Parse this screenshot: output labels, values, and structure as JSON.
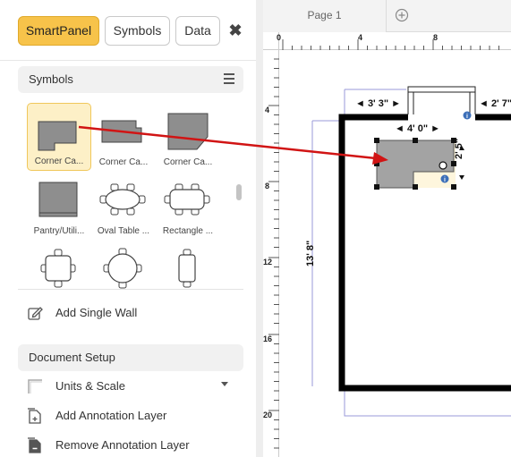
{
  "panel": {
    "tabs": [
      {
        "label": "SmartPanel",
        "active": true
      },
      {
        "label": "Symbols",
        "active": false
      },
      {
        "label": "Data",
        "active": false
      }
    ],
    "close_icon": "close-icon"
  },
  "symbols": {
    "title": "Symbols",
    "menu_icon": "hamburger-icon",
    "items": [
      {
        "label": "Corner Ca...",
        "selected": true
      },
      {
        "label": "Corner Ca..."
      },
      {
        "label": "Corner Ca..."
      },
      {
        "label": "Pantry/Utili..."
      },
      {
        "label": "Oval Table ..."
      },
      {
        "label": "Rectangle ..."
      },
      {
        "label": ""
      },
      {
        "label": ""
      },
      {
        "label": ""
      }
    ]
  },
  "actions": {
    "add_single_wall": "Add Single Wall"
  },
  "document_setup": {
    "title": "Document Setup",
    "units_scale": "Units & Scale",
    "add_annotation_layer": "Add Annotation Layer",
    "remove_annotation_layer": "Remove Annotation Layer"
  },
  "canvas": {
    "page_tab": "Page 1",
    "ruler_top": [
      "0",
      "4",
      "8"
    ],
    "ruler_left": [
      "4",
      "8",
      "12",
      "16",
      "20"
    ],
    "dimensions": {
      "top_left": "◄ 3' 3\" ►",
      "top_right": "◄ 2' 7\"",
      "object_width": "◄ 4' 0\" ►",
      "object_height": "2' 5\"",
      "room_height": "13' 8\""
    }
  },
  "colors": {
    "accent": "#f7c34a",
    "arrow": "#d11414",
    "wall": "#000000",
    "selection": "#fdf0c7"
  }
}
